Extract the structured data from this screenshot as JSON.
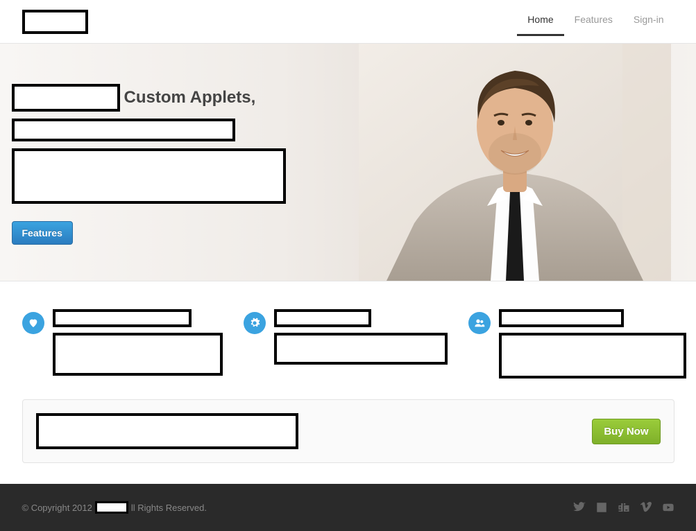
{
  "nav": {
    "items": [
      {
        "label": "Home",
        "active": true
      },
      {
        "label": "Features",
        "active": false
      },
      {
        "label": "Sign-in",
        "active": false
      }
    ]
  },
  "hero": {
    "headline_suffix": "Custom Applets,",
    "cta_label": "Features"
  },
  "features": [
    {
      "icon": "heart-icon"
    },
    {
      "icon": "gear-icon"
    },
    {
      "icon": "users-icon"
    }
  ],
  "cta": {
    "button_label": "Buy Now"
  },
  "footer": {
    "copyright_prefix": "© Copyright 2012",
    "copyright_suffix": "ll Rights Reserved.",
    "social": [
      "twitter",
      "facebook",
      "digg",
      "vimeo",
      "youtube"
    ]
  }
}
